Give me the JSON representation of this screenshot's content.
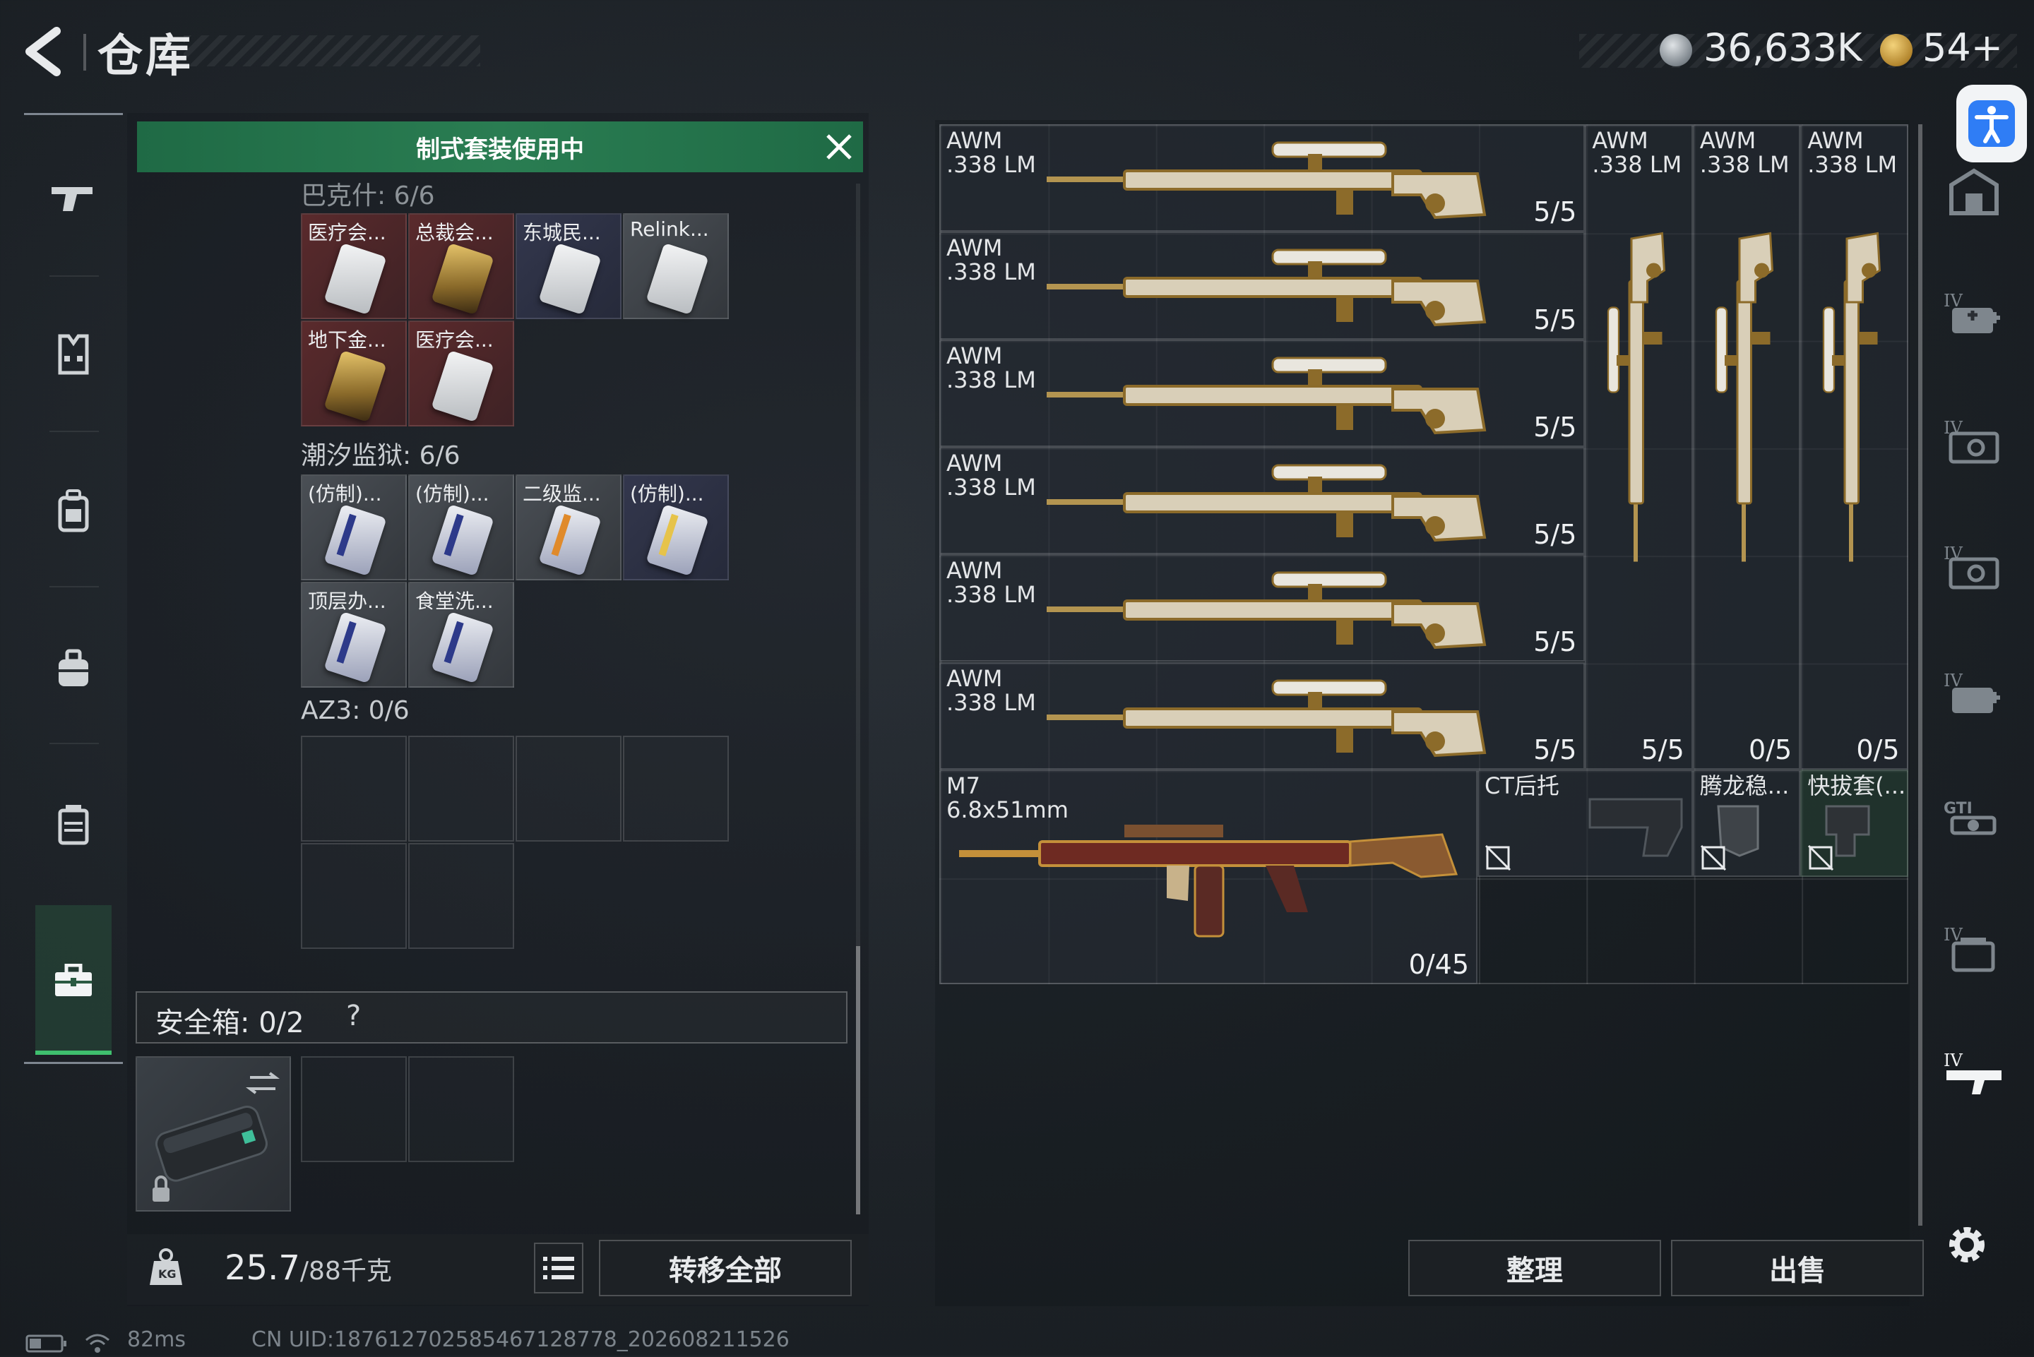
{
  "header": {
    "title": "仓库",
    "currency1": "36,633K",
    "currency2": "54+"
  },
  "left_nav": {
    "items": [
      "weapons",
      "armor",
      "backpack",
      "bag",
      "container",
      "briefcase"
    ],
    "active": "briefcase"
  },
  "container_panel": {
    "banner": "制式套装使用中",
    "sections": [
      {
        "label": "巴克什: 6/6",
        "items": [
          {
            "label": "医疗会...",
            "rarity": "red",
            "card": "white"
          },
          {
            "label": "总裁会...",
            "rarity": "red",
            "card": "gold"
          },
          {
            "label": "东城民...",
            "rarity": "blue",
            "card": "white"
          },
          {
            "label": "Relink...",
            "rarity": "gray",
            "card": "white"
          },
          {
            "label": "地下金...",
            "rarity": "red",
            "card": "gold"
          },
          {
            "label": "医疗会...",
            "rarity": "red",
            "card": "white"
          }
        ]
      },
      {
        "label": "潮汐监狱: 6/6",
        "items": [
          {
            "label": "(仿制)...",
            "rarity": "gray",
            "card": "purple"
          },
          {
            "label": "(仿制)...",
            "rarity": "gray",
            "card": "purple"
          },
          {
            "label": "二级监...",
            "rarity": "gray",
            "card": "orange"
          },
          {
            "label": "(仿制)...",
            "rarity": "blue",
            "card": "yellow"
          },
          {
            "label": "顶层办...",
            "rarity": "gray",
            "card": "purple"
          },
          {
            "label": "食堂洗...",
            "rarity": "gray",
            "card": "purple"
          }
        ]
      },
      {
        "label": "AZ3: 0/6",
        "items": []
      }
    ],
    "safe_box_label": "安全箱: 0/2",
    "safe_box_help": "?",
    "weight_value": "25.7",
    "weight_max": "/88千克",
    "transfer_all": "转移全部"
  },
  "stash": {
    "rifles_horizontal": [
      {
        "name": "AWM\n.338 LM",
        "ammo": "5/5"
      },
      {
        "name": "AWM\n.338 LM",
        "ammo": "5/5"
      },
      {
        "name": "AWM\n.338 LM",
        "ammo": "5/5"
      },
      {
        "name": "AWM\n.338 LM",
        "ammo": "5/5"
      },
      {
        "name": "AWM\n.338 LM",
        "ammo": "5/5"
      },
      {
        "name": "AWM\n.338 LM",
        "ammo": "5/5"
      }
    ],
    "rifles_vertical": [
      {
        "name": "AWM\n.338 LM",
        "ammo": "5/5"
      },
      {
        "name": "AWM\n.338 LM",
        "ammo": "0/5"
      },
      {
        "name": "AWM\n.338 LM",
        "ammo": "0/5"
      }
    ],
    "m7": {
      "name": "M7\n6.8x51mm",
      "ammo": "0/45"
    },
    "attachments": [
      {
        "name": "CT后托"
      },
      {
        "name": "腾龙稳..."
      },
      {
        "name": "快拔套(..."
      }
    ],
    "sort_button": "整理",
    "sell_button": "出售"
  },
  "status": {
    "ping": "82ms",
    "uid": "CN UID:187612702585467128778_202608211526"
  },
  "colors": {
    "accent_green": "#3fbf6e",
    "banner_green": "#2a7d52",
    "accessibility_blue": "#2f7df5"
  }
}
